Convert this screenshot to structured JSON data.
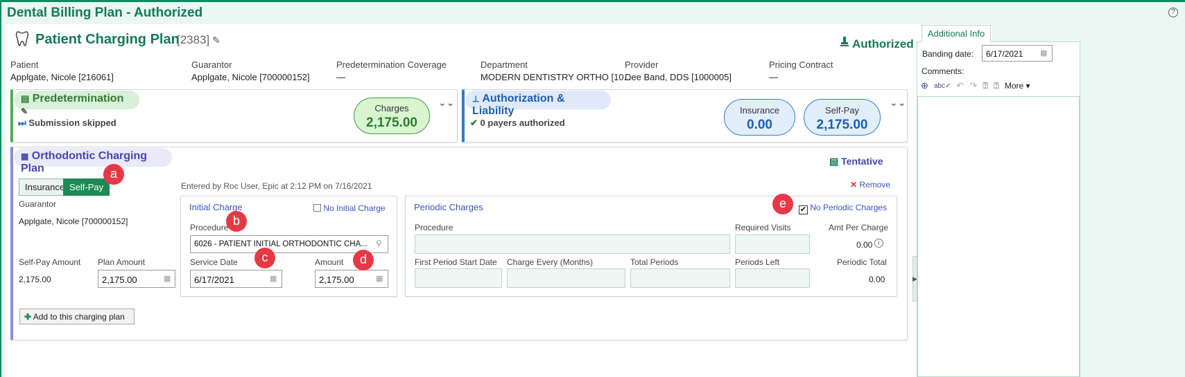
{
  "window": {
    "title": "Dental Billing Plan - Authorized",
    "help_symbol": "?"
  },
  "plan": {
    "title": "Patient Charging Plan",
    "id": "[2383]",
    "status": "Authorized"
  },
  "info": [
    {
      "label": "Patient",
      "value": "Applgate, Nicole [216061]"
    },
    {
      "label": "Guarantor",
      "value": "Applgate, Nicole [700000152]"
    },
    {
      "label": "Predetermination Coverage",
      "value": "—"
    },
    {
      "label": "Department",
      "value": "MODERN DENTISTRY ORTHO [10..."
    },
    {
      "label": "Provider",
      "value": "Dee Band, DDS [1000005]"
    },
    {
      "label": "Pricing Contract",
      "value": "—"
    }
  ],
  "predetermination": {
    "title": "Predetermination",
    "status": "Submission skipped",
    "charges_label": "Charges",
    "charges_value": "2,175.00"
  },
  "authorization": {
    "title": "Authorization & Liability",
    "status": "0 payers authorized",
    "insurance_label": "Insurance",
    "insurance_value": "0.00",
    "selfpay_label": "Self-Pay",
    "selfpay_value": "2,175.00"
  },
  "ortho": {
    "title": "Orthodontic Charging Plan",
    "status": "Tentative",
    "tabs": [
      "Insurance",
      "Self-Pay"
    ],
    "active_tab": "Self-Pay",
    "entered_by": "Entered by Roc User, Epic at 2:12 PM on 7/16/2021",
    "remove_label": "Remove",
    "guarantor_label": "Guarantor",
    "guarantor_value": "Applgate, Nicole [700000152]",
    "selfpay_amount_label": "Self-Pay Amount",
    "selfpay_amount_value": "2,175.00",
    "plan_amount_label": "Plan Amount",
    "plan_amount_value": "2,175.00",
    "add_button": "Add to this charging plan"
  },
  "initial_charge": {
    "title": "Initial Charge",
    "no_initial_label": "No Initial Charge",
    "no_initial_checked": false,
    "procedure_label": "Procedure",
    "procedure_value": "6026 - PATIENT INITIAL ORTHODONTIC CHA...",
    "service_date_label": "Service Date",
    "service_date_value": "6/17/2021",
    "amount_label": "Amount",
    "amount_value": "2,175.00"
  },
  "periodic": {
    "title": "Periodic Charges",
    "no_periodic_label": "No Periodic Charges",
    "no_periodic_checked": true,
    "procedure_label": "Procedure",
    "required_visits_label": "Required Visits",
    "amt_per_charge_label": "Amt Per Charge",
    "amt_per_charge_value": "0.00",
    "first_period_label": "First Period Start Date",
    "charge_every_label": "Charge Every (Months)",
    "total_periods_label": "Total Periods",
    "periods_left_label": "Periods Left",
    "periodic_total_label": "Periodic Total",
    "periodic_total_value": "0.00"
  },
  "markers": [
    "a",
    "b",
    "c",
    "d",
    "e"
  ],
  "sidebar": {
    "tab": "Additional Info",
    "banding_label": "Banding date:",
    "banding_value": "6/17/2021",
    "comments_label": "Comments:",
    "more_label": "More"
  },
  "colors": {
    "brand": "#127a5a",
    "accent_blue": "#3a54c2",
    "marker": "#e63946",
    "pred_green": "#4caf50",
    "auth_blue": "#2a7bd8"
  }
}
